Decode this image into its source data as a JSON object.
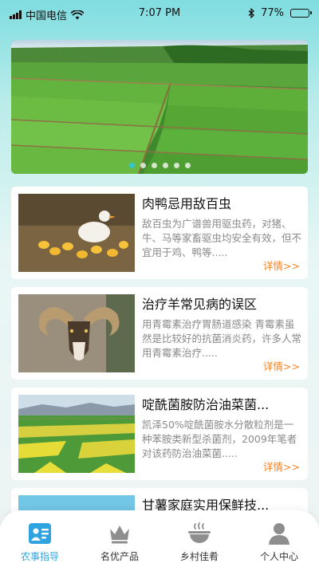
{
  "status_bar": {
    "carrier": "中国电信",
    "time": "7:07 PM",
    "battery": "77%",
    "battery_level": 0.77
  },
  "banner": {
    "dot_count": 6,
    "active_dot": 0
  },
  "articles": [
    {
      "title": "肉鸭忌用敌百虫",
      "desc": "敌百虫为广谱兽用驱虫药，对猪、牛、马等家畜驱虫均安全有效，但不宜用于鸡、鸭等.....",
      "more": "详情>>"
    },
    {
      "title": "治疗羊常见病的误区",
      "desc": "用青霉素治疗胃肠道感染  青霉素虽然是比较好的抗菌消炎药，许多人常用青霉素治疗.....",
      "more": "详情>>"
    },
    {
      "title": "啶酰菌胺防治油菜菌...",
      "desc": "凯泽50%啶酰菌胺水分散粒剂是一种苯胺类新型杀菌剂，2009年笔者对该药防治油菜菌.....",
      "more": "详情>>"
    },
    {
      "title": "甘薯家庭实用保鲜技..."
    }
  ],
  "nav": [
    {
      "label": "农事指导",
      "icon": "farming-guide-icon",
      "active": true
    },
    {
      "label": "名优产品",
      "icon": "crown-icon",
      "active": false
    },
    {
      "label": "乡村佳肴",
      "icon": "bowl-icon",
      "active": false
    },
    {
      "label": "个人中心",
      "icon": "user-icon",
      "active": false
    }
  ],
  "colors": {
    "accent": "#2ea3e0",
    "more_link": "#f58220",
    "active_dot": "#34c6d0"
  }
}
